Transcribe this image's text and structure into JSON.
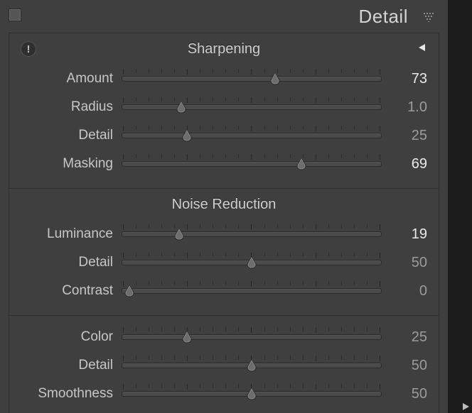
{
  "panel": {
    "title": "Detail"
  },
  "sections": {
    "sharpening": {
      "title": "Sharpening",
      "sliders": {
        "amount": {
          "label": "Amount",
          "value": "73",
          "pos": 0.59,
          "dim": false
        },
        "radius": {
          "label": "Radius",
          "value": "1.0",
          "pos": 0.23,
          "dim": true
        },
        "detail": {
          "label": "Detail",
          "value": "25",
          "pos": 0.25,
          "dim": true
        },
        "masking": {
          "label": "Masking",
          "value": "69",
          "pos": 0.69,
          "dim": false
        }
      }
    },
    "noise": {
      "title": "Noise Reduction",
      "sliders": {
        "luminance": {
          "label": "Luminance",
          "value": "19",
          "pos": 0.22,
          "dim": false
        },
        "detail": {
          "label": "Detail",
          "value": "50",
          "pos": 0.5,
          "dim": true
        },
        "contrast": {
          "label": "Contrast",
          "value": "0",
          "pos": 0.03,
          "dim": true
        }
      }
    },
    "color": {
      "sliders": {
        "color": {
          "label": "Color",
          "value": "25",
          "pos": 0.25,
          "dim": true
        },
        "detail": {
          "label": "Detail",
          "value": "50",
          "pos": 0.5,
          "dim": true
        },
        "smoothness": {
          "label": "Smoothness",
          "value": "50",
          "pos": 0.5,
          "dim": true
        }
      }
    }
  }
}
